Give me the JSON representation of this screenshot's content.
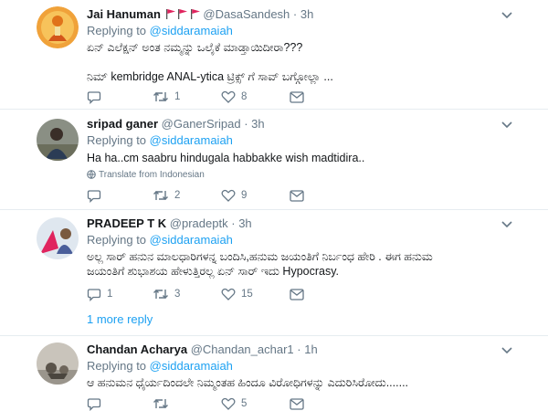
{
  "tweets": [
    {
      "name": "Jai Hanuman",
      "handle": "@DasaSandesh",
      "dot": "·",
      "time": "3h",
      "replying_prefix": "Replying to ",
      "replying_to": "@siddaramaiah",
      "lines": [
        "ಏನ್ ಎಲೆಕ್ಷನ್ ಅಂತ ನಮ್ಮನ್ನು ಒಲೈಕೆ ಮಾಡ್ತಾಯಿದೀರಾ???",
        "",
        "ನಿಮ್ kembridge ANAL-ytica ಟ್ರಿಕ್ಸ್ ಗೆ ಸಾವ್ ಬಗ್ಗೋಲ್ಲಾ ..."
      ],
      "replies": "",
      "retweets": "1",
      "likes": "8"
    },
    {
      "name": "sripad ganer",
      "handle": "@GanerSripad",
      "dot": "·",
      "time": "3h",
      "replying_prefix": "Replying to ",
      "replying_to": "@siddaramaiah",
      "lines": [
        "Ha ha..cm saabru hindugala habbakke wish madtidira.."
      ],
      "translate": "Translate from Indonesian",
      "replies": "",
      "retweets": "2",
      "likes": "9"
    },
    {
      "name": "PRADEEP T K",
      "handle": "@pradeptk",
      "dot": "·",
      "time": "3h",
      "replying_prefix": "Replying to ",
      "replying_to": "@siddaramaiah",
      "lines": [
        "ಅಲ್ಲ ಸಾರ್ ಹನುನ ಮಾಲಧಾರಿಗಳನ್ನ ಬಂದಿಸಿ,ಹನುಮ ಜಯಂತಿಗೆ ನಿರ್ಬಂಧ ಹೇರಿ . ಈಗ ಹನುಮ",
        "ಜಯಂತಿಗೆ ಶುಭಾಶಯ ಹೇಳುತ್ತಿರಲ್ಲ ಏನ್ ಸಾರ್ ಇದು Hypocrasy."
      ],
      "replies": "1",
      "retweets": "3",
      "likes": "15",
      "more_replies": "1 more reply"
    },
    {
      "name": "Chandan Acharya",
      "handle": "@Chandan_achar1",
      "dot": "·",
      "time": "1h",
      "replying_prefix": "Replying to ",
      "replying_to": "@siddaramaiah",
      "lines": [
        "ಆ ಹನುಮನ ಧೈರ್ಯದಿಂದಲೇ ನಿಮ್ಮಂತಹ ಹಿಂದೂ ವಿರೋಧಿಗಳನ್ನು ಎದುರಿಸಿರೋದು......."
      ],
      "replies": "",
      "retweets": "",
      "likes": "5"
    }
  ],
  "colors": {
    "accent": "#1da1f2",
    "muted": "#657786",
    "text": "#14171a",
    "divider": "#e6ecf0",
    "flag": "#e0245e"
  },
  "icons": [
    "reply-icon",
    "retweet-icon",
    "like-icon",
    "message-icon",
    "caret-down-icon",
    "globe-icon",
    "flag-icon"
  ]
}
